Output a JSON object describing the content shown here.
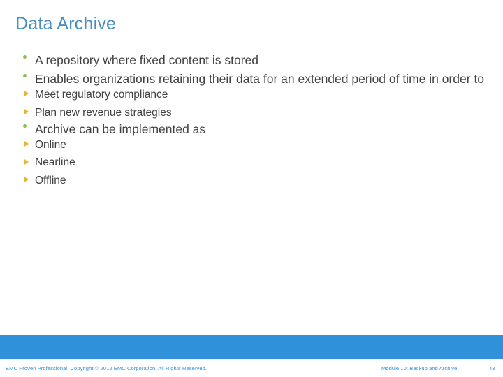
{
  "slide": {
    "title": "Data Archive",
    "title_color": "#4a8fc2",
    "background_color": "#ffffff",
    "body_text_color": "#414141",
    "level1_bullet_color": "#8dbf4a",
    "level2_bullet_color": "#e8b63b"
  },
  "content": {
    "bullet1": {
      "text": "A repository where fixed content is stored",
      "marker": "green-dot-bullet-icon"
    },
    "bullet2": {
      "text": "Enables organizations retaining their data for an extended period of time in order to",
      "marker": "green-dot-bullet-icon"
    },
    "bullet2_subitems": [
      {
        "text": "Meet regulatory compliance",
        "marker": "amber-triangle-bullet-icon"
      },
      {
        "text": "Plan new revenue strategies",
        "marker": "amber-triangle-bullet-icon"
      }
    ],
    "bullet3": {
      "text": "Archive can be implemented as",
      "marker": "green-dot-bullet-icon"
    },
    "bullet3_subitems": [
      {
        "text": "Online",
        "marker": "amber-triangle-bullet-icon"
      },
      {
        "text": "Nearline",
        "marker": "amber-triangle-bullet-icon"
      },
      {
        "text": "Offline",
        "marker": "amber-triangle-bullet-icon"
      }
    ]
  },
  "footer": {
    "band_color": "#2e91da",
    "text_color": "#2e91da",
    "copyright": "EMC Proven Professional. Copyright © 2012 EMC Corporation. All Rights Reserved.",
    "module": "Module 10: Backup and Archive",
    "page_number": "43"
  }
}
